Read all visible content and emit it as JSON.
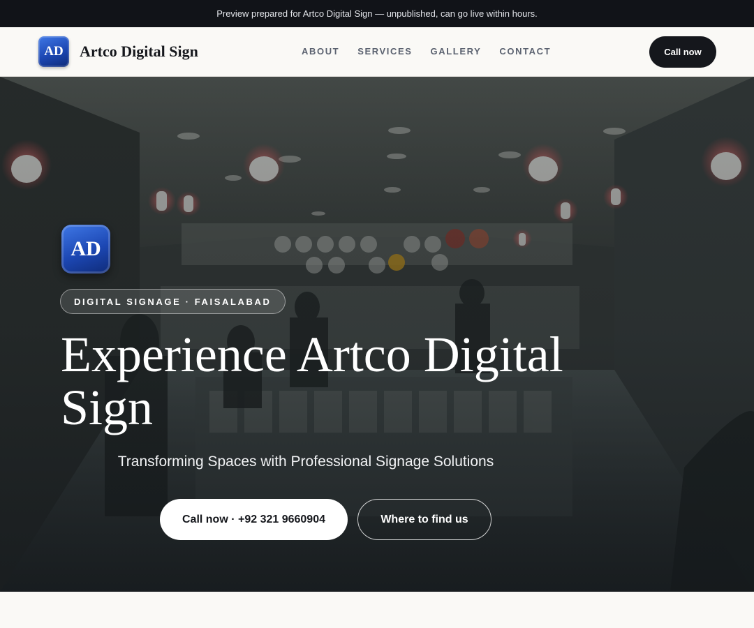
{
  "banner": {
    "text": "Preview prepared for Artco Digital Sign — unpublished, can go live within hours."
  },
  "header": {
    "logo_initials": "AD",
    "brand_name": "Artco Digital Sign",
    "nav": [
      {
        "label": "ABOUT"
      },
      {
        "label": "SERVICES"
      },
      {
        "label": "GALLERY"
      },
      {
        "label": "CONTACT"
      }
    ],
    "cta_label": "Call now"
  },
  "hero": {
    "logo_initials": "AD",
    "tagline": "DIGITAL SIGNAGE · FAISALABAD",
    "headline": "Experience Artco Digital Sign",
    "subheadline": "Transforming Spaces with Professional Signage Solutions",
    "primary_button": "Call now · +92 321 9660904",
    "secondary_button": "Where to find us",
    "background_image": "store interior with hanging lamps and shelves of crockery"
  },
  "colors": {
    "topbar_bg": "#111318",
    "accent_dark": "#15171c",
    "logo_blue": "#1c47b3"
  }
}
